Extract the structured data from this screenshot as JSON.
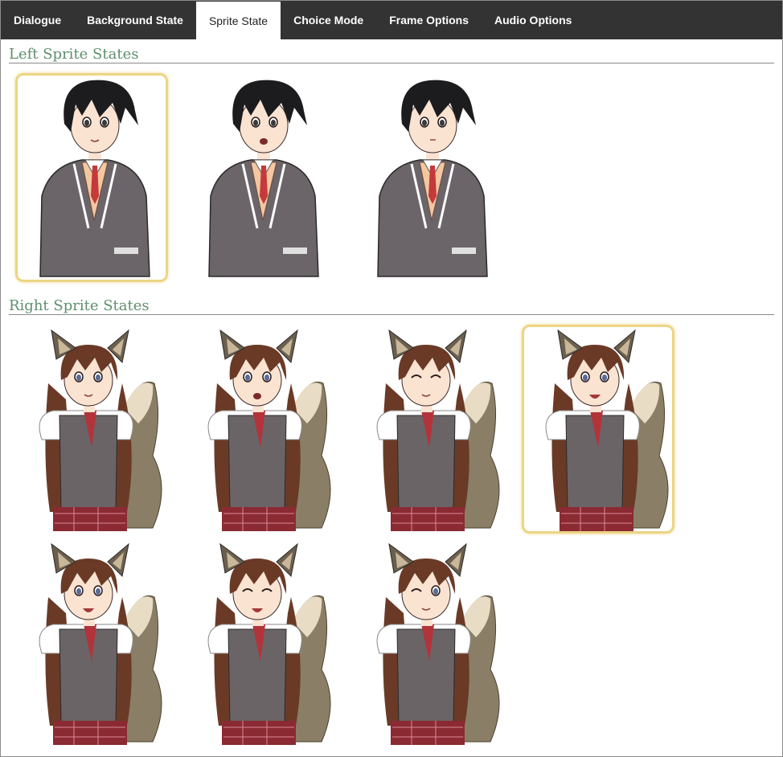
{
  "tabs": [
    {
      "id": "dialogue",
      "label": "Dialogue",
      "active": false
    },
    {
      "id": "background-state",
      "label": "Background State",
      "active": false
    },
    {
      "id": "sprite-state",
      "label": "Sprite State",
      "active": true
    },
    {
      "id": "choice-mode",
      "label": "Choice Mode",
      "active": false
    },
    {
      "id": "frame-options",
      "label": "Frame Options",
      "active": false
    },
    {
      "id": "audio-options",
      "label": "Audio Options",
      "active": false
    }
  ],
  "left_sprites": {
    "title": "Left Sprite States",
    "states": [
      {
        "expression": "smile",
        "selected": true
      },
      {
        "expression": "open-mouth",
        "selected": false
      },
      {
        "expression": "neutral-side",
        "selected": false
      }
    ]
  },
  "right_sprites": {
    "title": "Right Sprite States",
    "states": [
      {
        "expression": "smile",
        "selected": false
      },
      {
        "expression": "shocked",
        "selected": false
      },
      {
        "expression": "eyes-closed-smile",
        "selected": false
      },
      {
        "expression": "happy-open",
        "selected": true
      },
      {
        "expression": "laugh",
        "selected": false
      },
      {
        "expression": "laugh-closed",
        "selected": false
      },
      {
        "expression": "wink",
        "selected": false
      }
    ]
  },
  "colors": {
    "tabbar": "#333333",
    "section_title": "#5e8f6b",
    "selected_border": "#ecd585",
    "boy_hair": "#1c1c1f",
    "boy_jacket": "#6b6468",
    "boy_vest": "#f3c7a0",
    "girl_hair": "#6a3a26",
    "girl_vest": "#6a6466",
    "girl_tail": "#8a7f66",
    "skirt": "#8b2a33",
    "skin": "#fbe3d2"
  }
}
